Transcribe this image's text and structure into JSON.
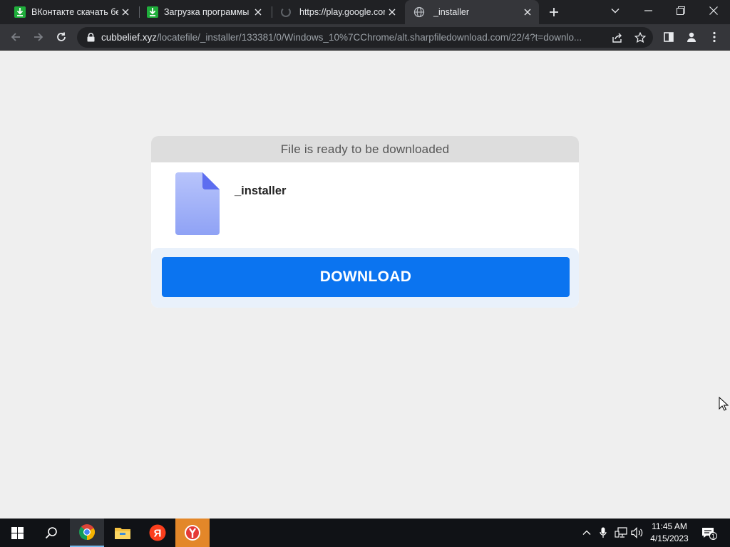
{
  "browser": {
    "tabs": [
      {
        "title": "ВКонтакте скачать бесплатно",
        "icon": "download-icon",
        "active": false
      },
      {
        "title": "Загрузка программы с",
        "icon": "download-icon",
        "active": false
      },
      {
        "title": "https://play.google.com",
        "icon": "loading-spinner-icon",
        "active": false
      },
      {
        "title": "_installer",
        "icon": "globe-icon",
        "active": true
      }
    ],
    "url_host": "cubbelief.xyz",
    "url_path": "/locatefile/_installer/133381/0/Windows_10%7CChrome/alt.sharpfiledownload.com/22/4?t=downlo..."
  },
  "page": {
    "header": "File is ready to be downloaded",
    "file_name": "_installer",
    "download_label": "DOWNLOAD",
    "accent_color": "#0b74f0"
  },
  "taskbar": {
    "apps": [
      "start-icon",
      "search-icon",
      "chrome-icon",
      "file-explorer-icon",
      "yandex-icon",
      "yandex-browser-icon"
    ],
    "time": "11:45 AM",
    "date": "4/15/2023",
    "notification_count": "1"
  }
}
